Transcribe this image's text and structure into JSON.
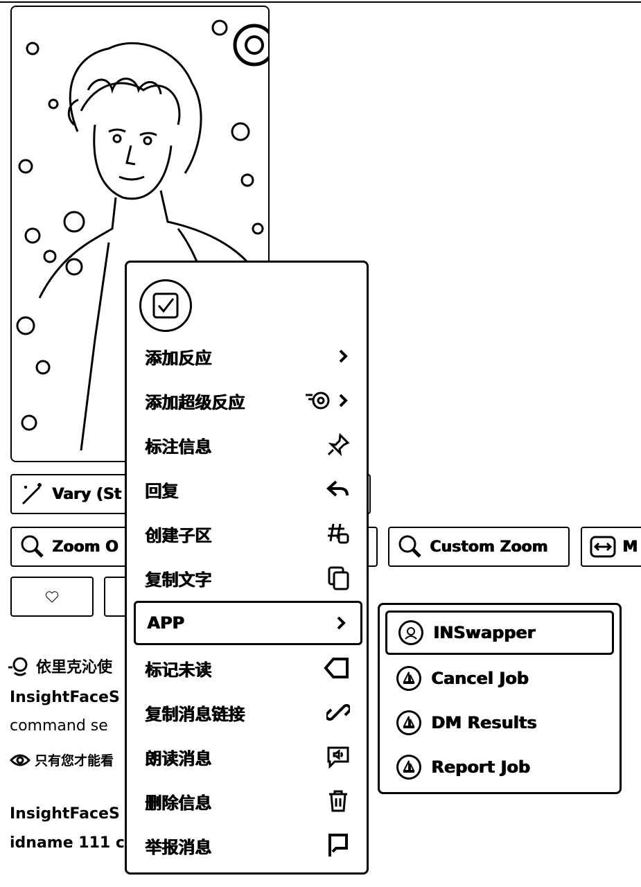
{
  "message": {
    "buttons": {
      "vary_label": "Vary (St",
      "zoom_out_label": "Zoom O",
      "custom_zoom_label": "Custom Zoom",
      "make_square_label": "M"
    },
    "bot_line_1": "依里克沁使",
    "bot_line_2": "InsightFaceS",
    "bot_line_3": "command se",
    "visibility_note": "只有您才能看",
    "bot_line_4": "InsightFaceS",
    "bot_line_5": "idname 111 cr"
  },
  "context_menu": {
    "items": [
      {
        "label": "添加反应",
        "icon": "chevron-right-icon"
      },
      {
        "label": "添加超级反应",
        "icon": "super-reaction-icon"
      },
      {
        "label": "标注信息",
        "icon": "pin-icon"
      },
      {
        "label": "回复",
        "icon": "reply-icon"
      },
      {
        "label": "创建子区",
        "icon": "thread-icon"
      },
      {
        "label": "复制文字",
        "icon": "copy-icon"
      },
      {
        "label": "APP",
        "icon": "chevron-right-icon"
      },
      {
        "label": "标记未读",
        "icon": "mark-unread-icon"
      },
      {
        "label": "复制消息链接",
        "icon": "link-icon"
      },
      {
        "label": "朗读消息",
        "icon": "speak-icon"
      },
      {
        "label": "删除信息",
        "icon": "trash-icon"
      },
      {
        "label": "举报消息",
        "icon": "flag-icon"
      }
    ]
  },
  "app_submenu": {
    "items": [
      {
        "label": "INSwapper",
        "icon": "inswapper-avatar-icon"
      },
      {
        "label": "Cancel Job",
        "icon": "midjourney-boat-icon"
      },
      {
        "label": "DM Results",
        "icon": "midjourney-boat-icon"
      },
      {
        "label": "Report Job",
        "icon": "midjourney-boat-icon"
      }
    ]
  }
}
